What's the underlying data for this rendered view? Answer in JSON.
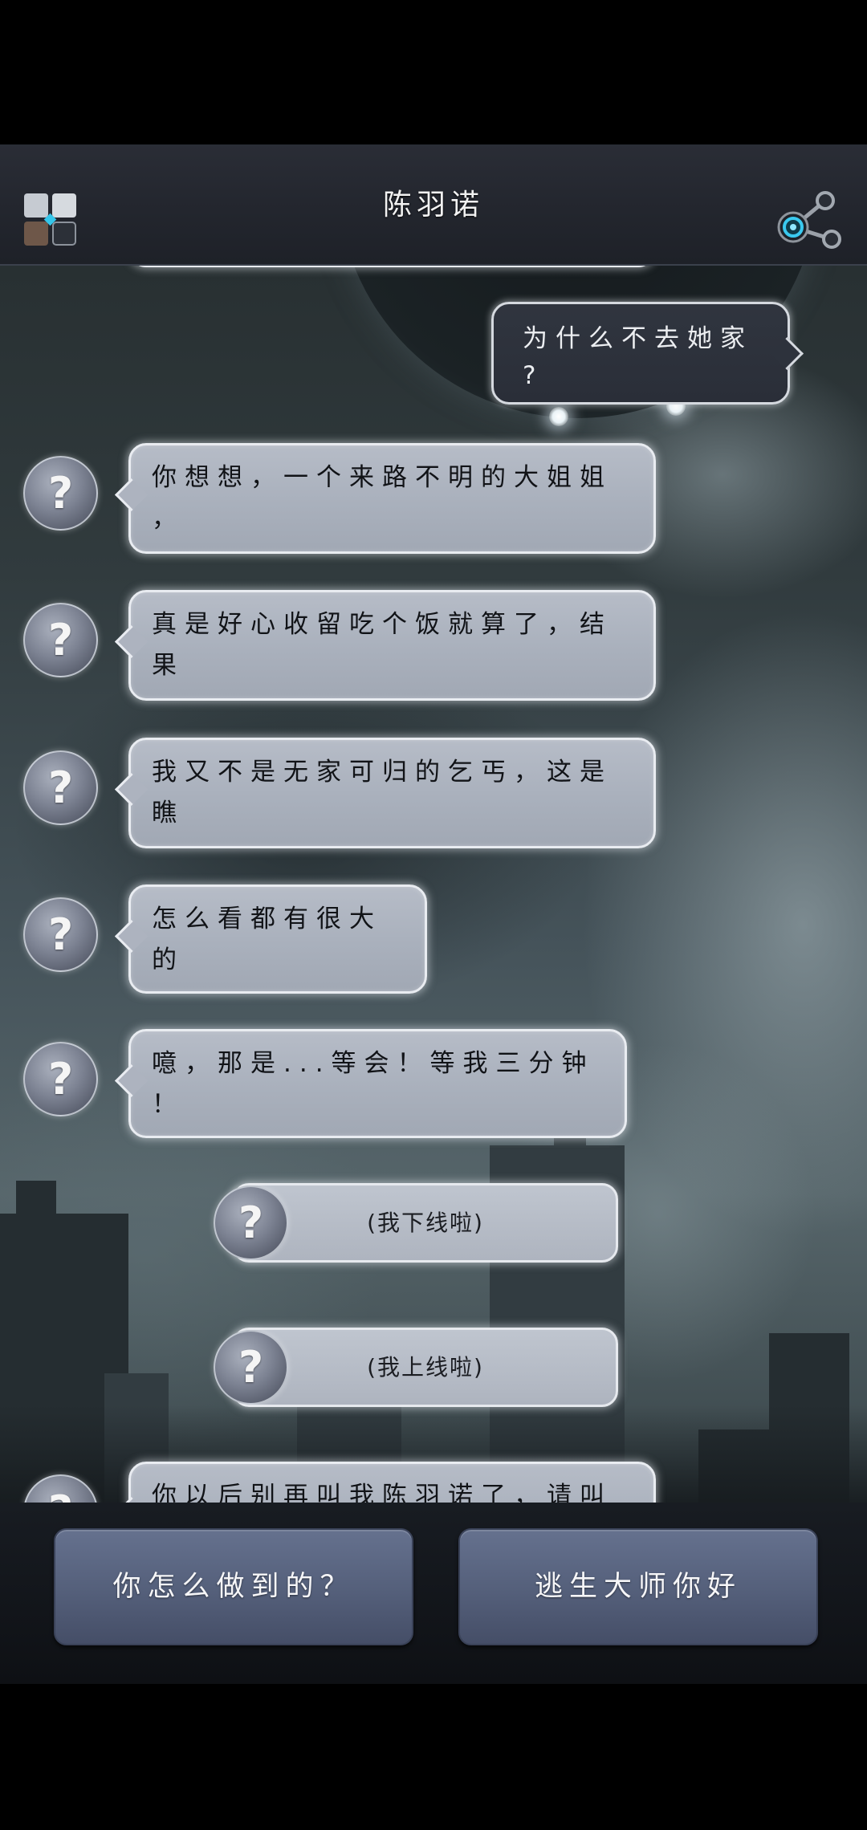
{
  "header": {
    "title": "陈羽诺",
    "menu_icon": "grid-menu-icon",
    "share_icon": "share-icon"
  },
  "messages": [
    {
      "text": "为什么不去她家?"
    },
    {
      "avatar": "?",
      "text": "你想想，一个来路不明的大姐姐，"
    },
    {
      "avatar": "?",
      "text": "真是好心收留吃个饭就算了，结果"
    },
    {
      "avatar": "?",
      "text": "我又不是无家可归的乞丐，这是瞧"
    },
    {
      "avatar": "?",
      "text": "怎么看都有很大的"
    },
    {
      "avatar": "?",
      "text": "噫，那是...等会！等我三分钟！"
    },
    {
      "avatar": "?",
      "text": "(我下线啦)"
    },
    {
      "avatar": "?",
      "text": "(我上线啦)"
    },
    {
      "avatar": "?",
      "text": "你以后别再叫我陈羽诺了，请叫"
    }
  ],
  "reply_options": [
    {
      "label": "你怎么做到的？"
    },
    {
      "label": "逃生大师你好"
    }
  ],
  "colors": {
    "header_background": "#22252d",
    "incoming_bubble": "#abb1bd",
    "outgoing_bubble": "#2b303b",
    "reply_button": "#56617d",
    "share_icon_accent": "#3ac9ef"
  }
}
